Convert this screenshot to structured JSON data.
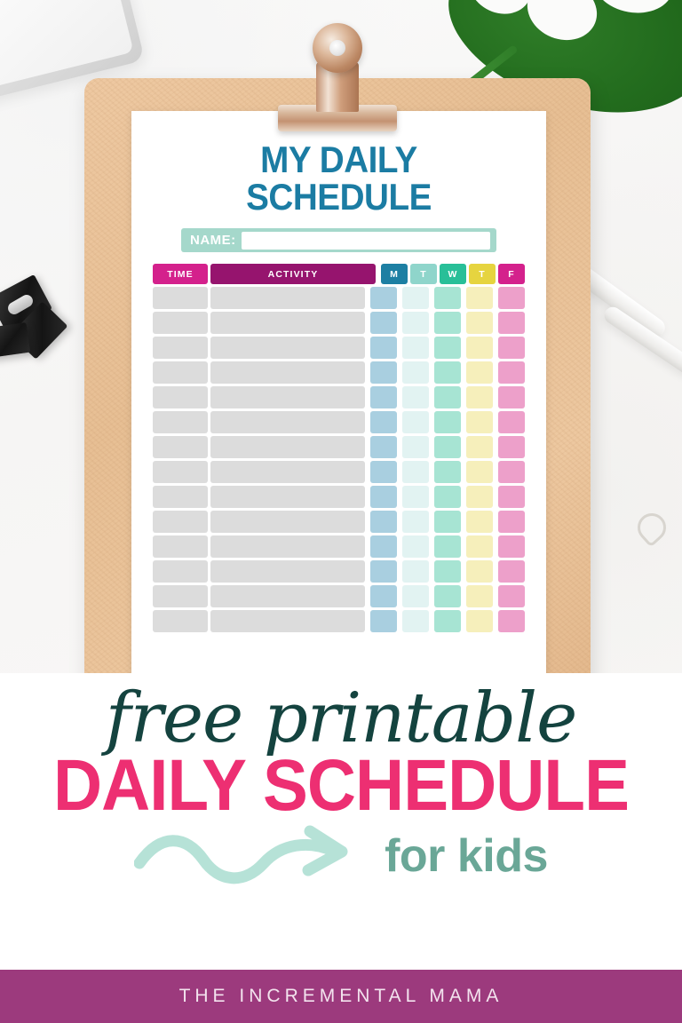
{
  "printable": {
    "title": "MY DAILY SCHEDULE",
    "name_label": "NAME:",
    "name_value": "",
    "name_placeholder": "",
    "table": {
      "headers": [
        "TIME",
        "ACTIVITY",
        "M",
        "T",
        "W",
        "T",
        "F"
      ],
      "row_count": 14,
      "rows": [
        {
          "time": "",
          "activity": "",
          "m": "",
          "t1": "",
          "w": "",
          "t2": "",
          "f": ""
        },
        {
          "time": "",
          "activity": "",
          "m": "",
          "t1": "",
          "w": "",
          "t2": "",
          "f": ""
        },
        {
          "time": "",
          "activity": "",
          "m": "",
          "t1": "",
          "w": "",
          "t2": "",
          "f": ""
        },
        {
          "time": "",
          "activity": "",
          "m": "",
          "t1": "",
          "w": "",
          "t2": "",
          "f": ""
        },
        {
          "time": "",
          "activity": "",
          "m": "",
          "t1": "",
          "w": "",
          "t2": "",
          "f": ""
        },
        {
          "time": "",
          "activity": "",
          "m": "",
          "t1": "",
          "w": "",
          "t2": "",
          "f": ""
        },
        {
          "time": "",
          "activity": "",
          "m": "",
          "t1": "",
          "w": "",
          "t2": "",
          "f": ""
        },
        {
          "time": "",
          "activity": "",
          "m": "",
          "t1": "",
          "w": "",
          "t2": "",
          "f": ""
        },
        {
          "time": "",
          "activity": "",
          "m": "",
          "t1": "",
          "w": "",
          "t2": "",
          "f": ""
        },
        {
          "time": "",
          "activity": "",
          "m": "",
          "t1": "",
          "w": "",
          "t2": "",
          "f": ""
        },
        {
          "time": "",
          "activity": "",
          "m": "",
          "t1": "",
          "w": "",
          "t2": "",
          "f": ""
        },
        {
          "time": "",
          "activity": "",
          "m": "",
          "t1": "",
          "w": "",
          "t2": "",
          "f": ""
        },
        {
          "time": "",
          "activity": "",
          "m": "",
          "t1": "",
          "w": "",
          "t2": "",
          "f": ""
        },
        {
          "time": "",
          "activity": "",
          "m": "",
          "t1": "",
          "w": "",
          "t2": "",
          "f": ""
        }
      ]
    }
  },
  "overlay": {
    "script_text": "free printable",
    "headline_text": "DAILY SCHEDULE",
    "subline_text": "for kids"
  },
  "footer": {
    "brand": "THE INCREMENTAL MAMA"
  },
  "colors": {
    "title_teal": "#1b7ca3",
    "name_band": "#a5d8cb",
    "header_time_pink": "#d4218c",
    "header_activity_purple": "#96146e",
    "day_m": "#1d7fa3",
    "day_t1": "#8fd5cb",
    "day_w": "#28bf98",
    "day_t2": "#e6d43f",
    "day_f": "#d4218c",
    "col_m": "#a9cfe0",
    "col_t1": "#e2f3f2",
    "col_w": "#a7e4d3",
    "col_t2": "#f6efbb",
    "col_f": "#eda0ca",
    "row_gray": "#dcdcdc",
    "script_dark_teal": "#14433f",
    "headline_pink": "#ed2f72",
    "subline_sage": "#6aa797",
    "arrow_mint": "#b6e2d7",
    "footer_purple": "#9c3a7d",
    "footer_text": "#f3e3ee",
    "clipboard_cork": "#e7bf94"
  },
  "day_columns": [
    {
      "key": "m",
      "label": "M",
      "header_color": "#1d7fa3",
      "cell_color": "#a9cfe0"
    },
    {
      "key": "t1",
      "label": "T",
      "header_color": "#8fd5cb",
      "cell_color": "#e2f3f2"
    },
    {
      "key": "w",
      "label": "W",
      "header_color": "#28bf98",
      "cell_color": "#a7e4d3"
    },
    {
      "key": "t2",
      "label": "T",
      "header_color": "#e6d43f",
      "cell_color": "#f6efbb"
    },
    {
      "key": "f",
      "label": "F",
      "header_color": "#d4218c",
      "cell_color": "#eda0ca"
    }
  ],
  "scene_objects": [
    {
      "name": "laptop-corner"
    },
    {
      "name": "binder-clips"
    },
    {
      "name": "monstera-leaf"
    },
    {
      "name": "white-pens"
    },
    {
      "name": "heart-paper-clip"
    },
    {
      "name": "clipboard"
    },
    {
      "name": "clipboard-metal-clip"
    }
  ]
}
